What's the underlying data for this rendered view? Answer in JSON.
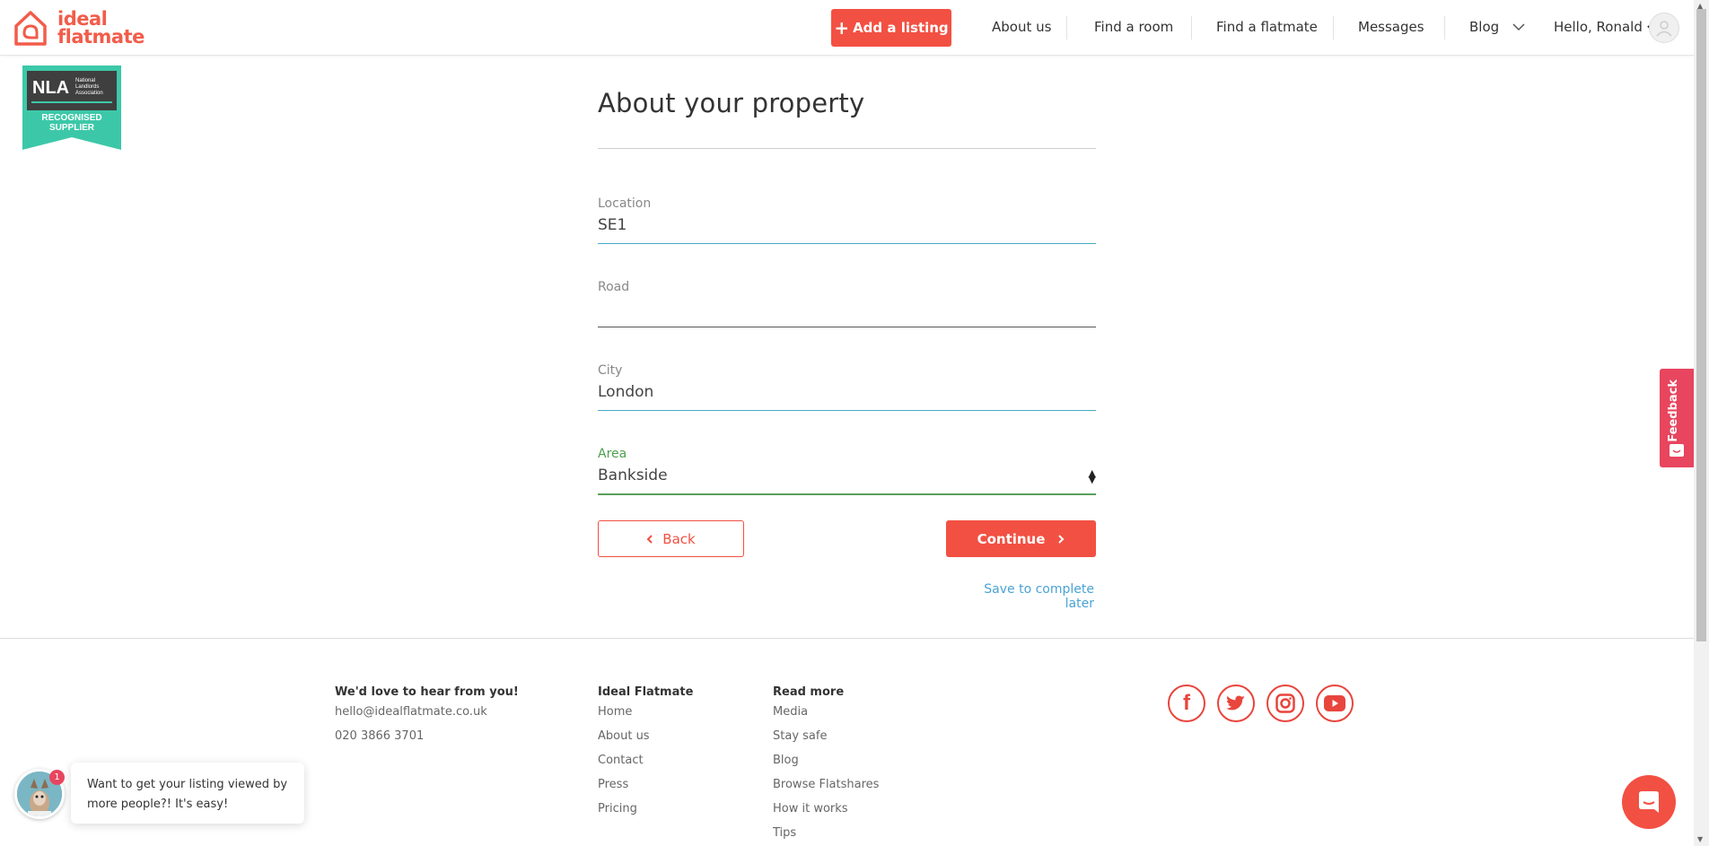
{
  "header": {
    "logo_line1": "ideal",
    "logo_line2": "flatmate",
    "add_listing": "Add a listing",
    "nav": [
      "About us",
      "Find a room",
      "Find a flatmate",
      "Messages",
      "Blog"
    ],
    "greeting": "Hello, Ronald"
  },
  "badge": {
    "abbr": "NLA",
    "org_line1": "National",
    "org_line2": "Landlords",
    "org_line3": "Association",
    "text_line1": "RECOGNISED",
    "text_line2": "SUPPLIER"
  },
  "form": {
    "title": "About your property",
    "fields": [
      {
        "label": "Location",
        "value": "SE1"
      },
      {
        "label": "Road",
        "value": ""
      },
      {
        "label": "City",
        "value": "London"
      },
      {
        "label": "Area",
        "value": "Bankside"
      }
    ],
    "back": "Back",
    "continue": "Continue",
    "save_later": "Save to complete later"
  },
  "feedback": "Feedback",
  "footer": {
    "contact_heading": "We'd love to hear from you!",
    "email": "hello@idealflatmate.co.uk",
    "phone": "020 3866 3701",
    "col2_heading": "Ideal Flatmate",
    "col2_links": [
      "Home",
      "About us",
      "Contact",
      "Press",
      "Pricing"
    ],
    "col3_heading": "Read more",
    "col3_links": [
      "Media",
      "Stay safe",
      "Blog",
      "Browse Flatshares",
      "How it works",
      "Tips"
    ],
    "social": [
      "facebook-icon",
      "twitter-icon",
      "instagram-icon",
      "youtube-icon"
    ]
  },
  "chat": {
    "badge_count": "1",
    "message": "Want to get your listing viewed by more people?! It's easy!"
  },
  "colors": {
    "brand": "#f25042",
    "link": "#4aa3d4",
    "field_active": "#48a9c5",
    "field_valid": "#5aa05a",
    "feedback": "#e8455f"
  }
}
